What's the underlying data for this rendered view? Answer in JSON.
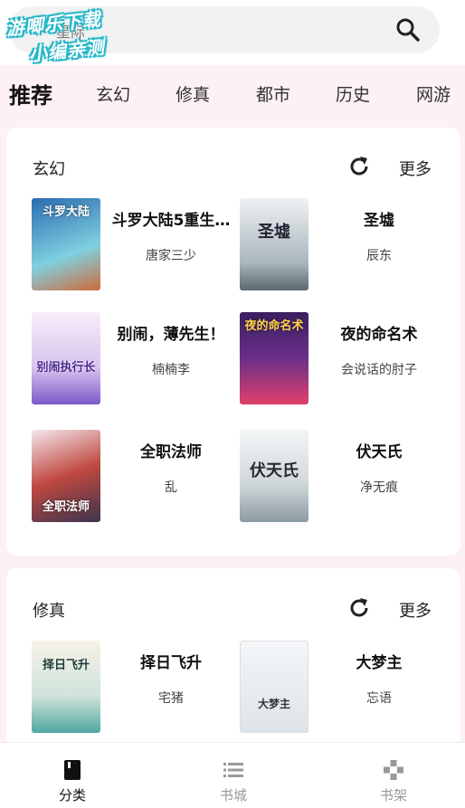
{
  "search": {
    "text": "星际"
  },
  "watermark": {
    "line1": "游唧乐下载",
    "line2": "小编亲测"
  },
  "tabs": [
    "推荐",
    "玄幻",
    "修真",
    "都市",
    "历史",
    "网游"
  ],
  "sections": [
    {
      "title": "玄幻",
      "more_label": "更多",
      "books": [
        {
          "title": "斗罗大陆5重生…",
          "author": "唐家三少",
          "cover_text": "斗罗大陆",
          "cover_colors": [
            "#2b6cb0",
            "#7fd0e0"
          ]
        },
        {
          "title": "圣墟",
          "author": "辰东",
          "cover_text": "圣墟",
          "cover_colors": [
            "#dfe6ea",
            "#6f7d86"
          ]
        },
        {
          "title": "别闹，薄先生！",
          "author": "楠楠李",
          "cover_text": "别闹执行长",
          "cover_colors": [
            "#f4e6f7",
            "#8a5ccf"
          ]
        },
        {
          "title": "夜的命名术",
          "author": "会说话的肘子",
          "cover_text": "夜的命名术",
          "cover_colors": [
            "#2a1a4a",
            "#e0406a"
          ]
        },
        {
          "title": "全职法师",
          "author": "乱",
          "cover_text": "全职法师",
          "cover_colors": [
            "#c0483f",
            "#f1e4e8"
          ]
        },
        {
          "title": "伏天氏",
          "author": "净无痕",
          "cover_text": "伏天氏",
          "cover_colors": [
            "#eef1f2",
            "#8c9aa2"
          ]
        }
      ]
    },
    {
      "title": "修真",
      "more_label": "更多",
      "books": [
        {
          "title": "择日飞升",
          "author": "宅猪",
          "cover_text": "择日飞升",
          "cover_colors": [
            "#f5f1e4",
            "#4fa8a0"
          ]
        },
        {
          "title": "大梦主",
          "author": "忘语",
          "cover_text": "大梦主",
          "cover_colors": [
            "#f1f4f6",
            "#c9d3da"
          ]
        }
      ]
    }
  ],
  "nav": [
    {
      "label": "分类",
      "icon": "book-icon",
      "active": true
    },
    {
      "label": "书城",
      "icon": "list-icon",
      "active": false
    },
    {
      "label": "书架",
      "icon": "gamepad-icon",
      "active": false
    }
  ],
  "colors": {
    "background": "#fdf1f4",
    "card": "#ffffff",
    "active_text": "#111111",
    "inactive_nav": "#999999"
  }
}
